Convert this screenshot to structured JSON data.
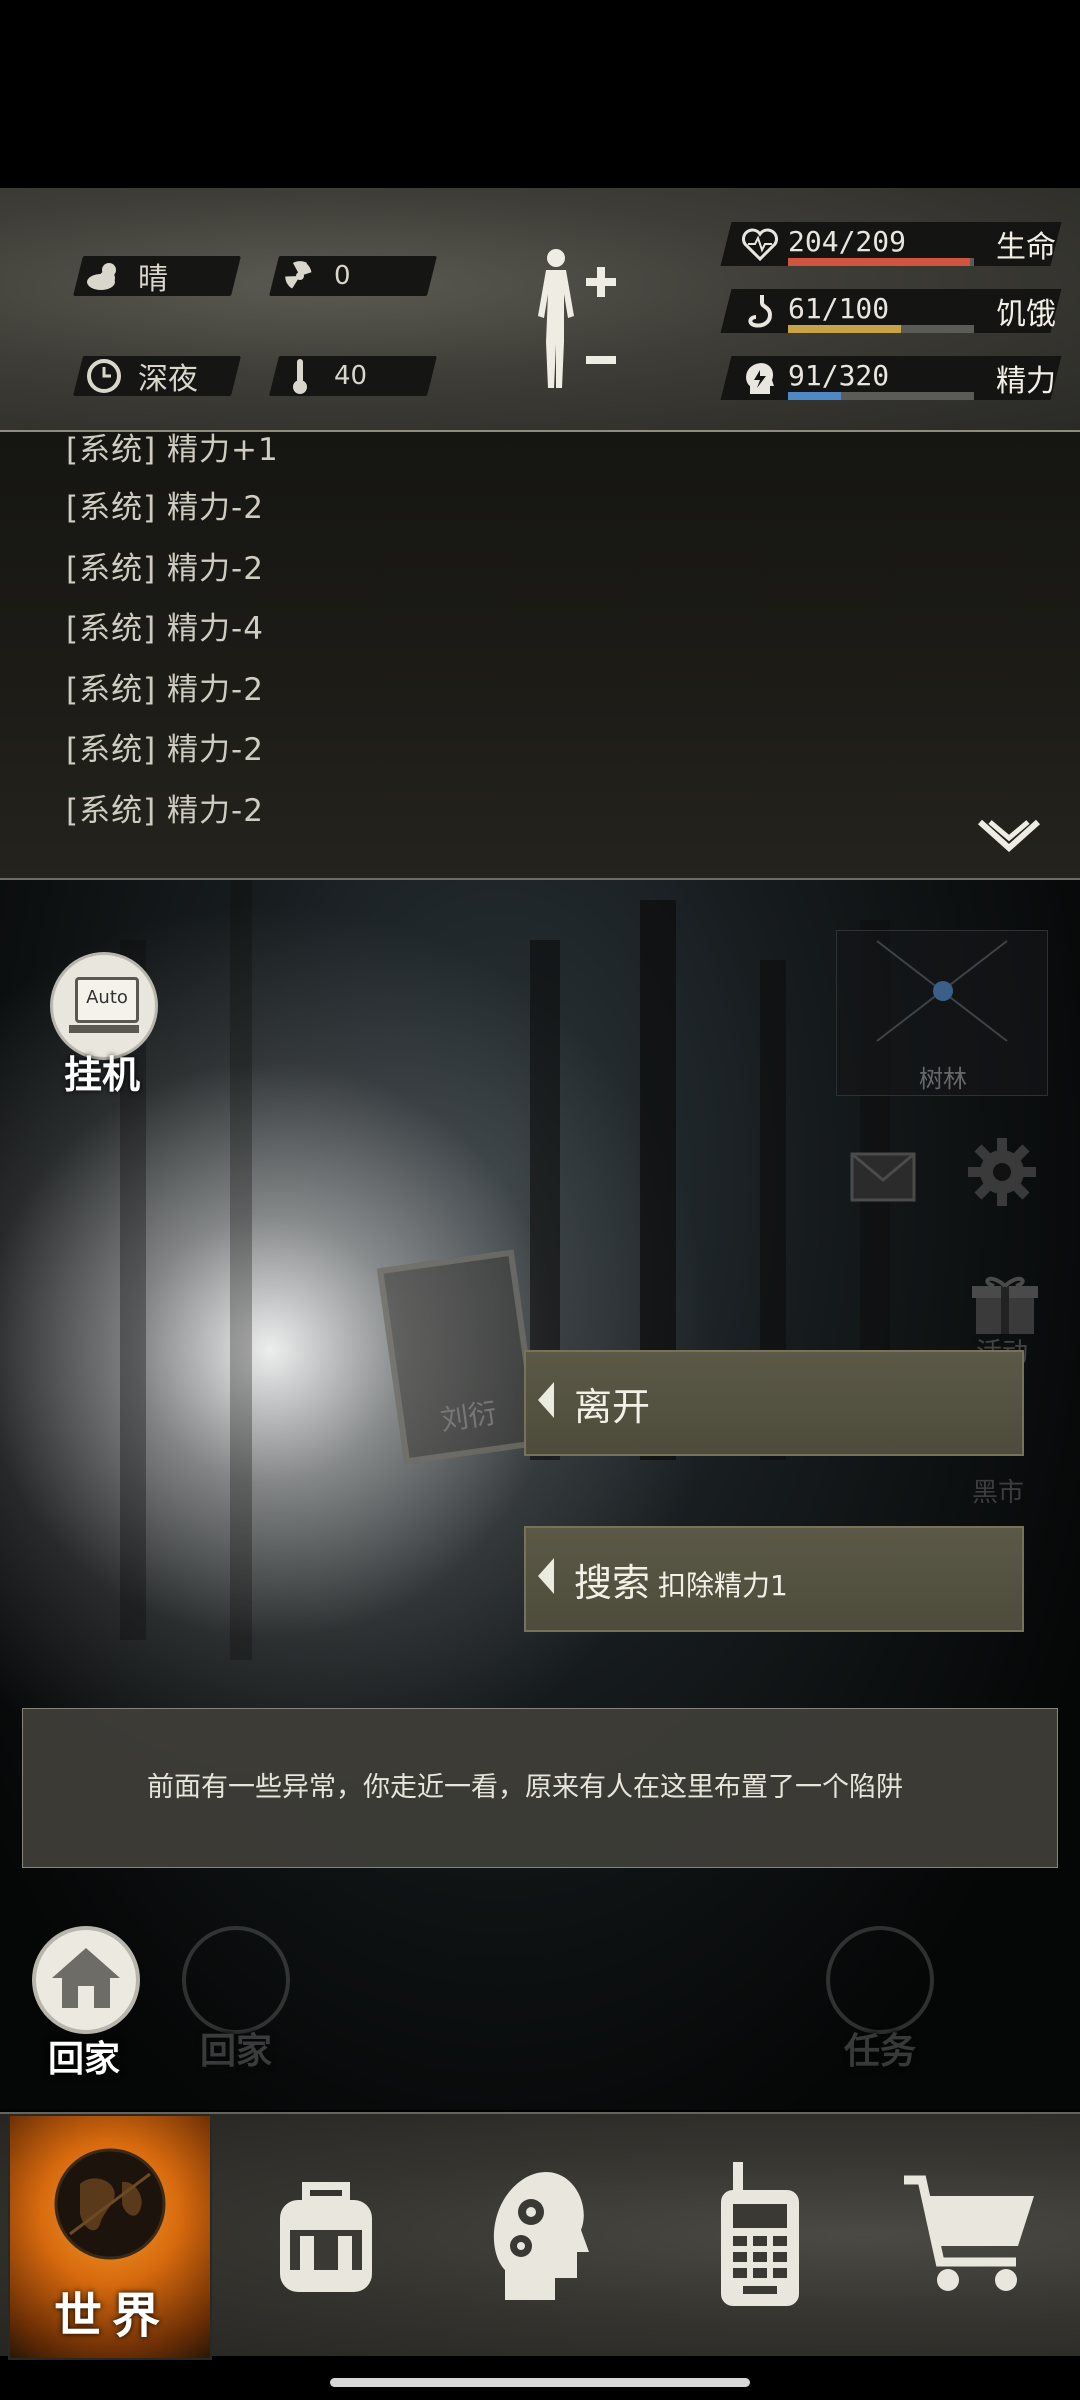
{
  "header": {
    "weather": {
      "icon": "partly-cloudy-icon",
      "value": "晴"
    },
    "radiation": {
      "icon": "radiation-icon",
      "value": "0"
    },
    "time": {
      "icon": "clock-icon",
      "value": "深夜"
    },
    "temperature": {
      "icon": "thermometer-icon",
      "value": "40"
    },
    "body": {
      "icon": "body-figure-icon",
      "plus": "+",
      "minus": "−"
    },
    "stats": [
      {
        "name": "生命",
        "value": "204/209",
        "fraction": 0.976,
        "color": "#d0553f",
        "icon": "heart-icon"
      },
      {
        "name": "饥饿",
        "value": "61/100",
        "fraction": 0.61,
        "color": "#c7a247",
        "icon": "stomach-icon"
      },
      {
        "name": "精力",
        "value": "91/320",
        "fraction": 0.284,
        "color": "#4f88c6",
        "icon": "energy-head-icon"
      }
    ]
  },
  "log": {
    "partial_line": "[系统] 精力+1",
    "lines": [
      "[系统] 精力-2",
      "[系统] 精力-2",
      "[系统] 精力-4",
      "[系统] 精力-2",
      "[系统] 精力-2",
      "[系统] 精力-2"
    ],
    "expand_icon": "double-chevron-down-icon"
  },
  "scene": {
    "auto_button": {
      "badge": "Auto",
      "label": "挂机"
    },
    "minimap_label": "树林",
    "card_label": "刘衍",
    "side_items": {
      "mail": "mail-icon",
      "settings": "gear-icon",
      "gift": "gift-icon",
      "gift_label": "活动",
      "market_label": "黑市"
    },
    "choices": [
      {
        "label": "离开",
        "sub": ""
      },
      {
        "label": "搜索",
        "sub": "扣除精力1"
      }
    ],
    "message": "前面有一些异常，你走近一看，原来有人在这里布置了一个陷阱",
    "home_button": "回家",
    "home_button_faded": "回家",
    "task_button": "任务"
  },
  "nav": {
    "items": [
      {
        "label": "世界",
        "icon": "globe-icon",
        "active": true
      },
      {
        "label": "",
        "icon": "backpack-icon"
      },
      {
        "label": "",
        "icon": "brain-gears-icon"
      },
      {
        "label": "",
        "icon": "walkie-talkie-icon"
      },
      {
        "label": "",
        "icon": "shopping-cart-icon"
      }
    ]
  }
}
